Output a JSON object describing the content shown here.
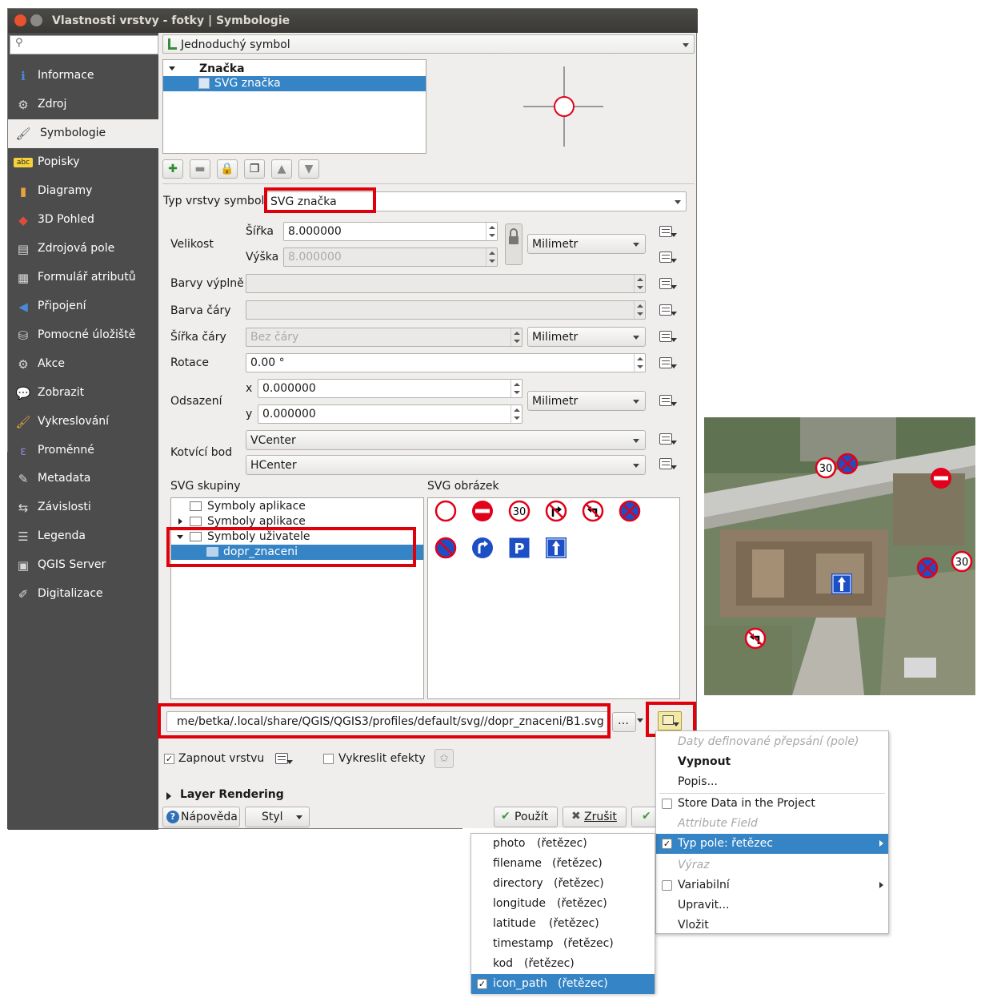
{
  "window": {
    "title": "Vlastnosti vrstvy - fotky | Symbologie"
  },
  "sidebar": {
    "items": [
      {
        "label": "Informace",
        "icon": "info-icon"
      },
      {
        "label": "Zdroj",
        "icon": "source-icon"
      },
      {
        "label": "Symbologie",
        "icon": "paintbrush-icon",
        "selected": true
      },
      {
        "label": "Popisky",
        "icon": "labels-icon"
      },
      {
        "label": "Diagramy",
        "icon": "diagram-icon"
      },
      {
        "label": "3D Pohled",
        "icon": "cube-icon"
      },
      {
        "label": "Zdrojová pole",
        "icon": "fields-icon"
      },
      {
        "label": "Formulář atributů",
        "icon": "form-icon"
      },
      {
        "label": "Připojení",
        "icon": "join-icon"
      },
      {
        "label": "Pomocné úložiště",
        "icon": "database-icon"
      },
      {
        "label": "Akce",
        "icon": "gear-icon"
      },
      {
        "label": "Zobrazit",
        "icon": "speech-bubble-icon"
      },
      {
        "label": "Vykreslování",
        "icon": "brush-icon"
      },
      {
        "label": "Proměnné",
        "icon": "epsilon-icon"
      },
      {
        "label": "Metadata",
        "icon": "metadata-icon"
      },
      {
        "label": "Závislosti",
        "icon": "dependencies-icon"
      },
      {
        "label": "Legenda",
        "icon": "legend-icon"
      },
      {
        "label": "QGIS Server",
        "icon": "server-icon"
      },
      {
        "label": "Digitalizace",
        "icon": "digitize-icon"
      }
    ]
  },
  "renderer": {
    "value": "Jednoduchý symbol"
  },
  "symbol_tree": {
    "root": "Značka",
    "child": "SVG značka"
  },
  "form": {
    "layer_type_label": "Typ vrstvy symbolu",
    "layer_type_value": "SVG značka",
    "size_label": "Velikost",
    "width_label": "Šířka",
    "width_value": "8.000000",
    "height_label": "Výška",
    "height_value": "8.000000",
    "unit": "Milimetr",
    "fill_color_label": "Barvy výplně",
    "stroke_color_label": "Barva čáry",
    "stroke_width_label": "Šířka čáry",
    "stroke_width_value": "Bez čáry",
    "rotation_label": "Rotace",
    "rotation_value": "0.00 °",
    "offset_label": "Odsazení",
    "offset_x_label": "x",
    "offset_x_value": "0.000000",
    "offset_y_label": "y",
    "offset_y_value": "0.000000",
    "anchor_label": "Kotvící bod",
    "anchor_v": "VCenter",
    "anchor_h": "HCenter"
  },
  "svg_groups": {
    "title": "SVG skupiny",
    "items": [
      "Symboly aplikace",
      "Symboly aplikace",
      "Symboly uživatele",
      "dopr_znaceni"
    ]
  },
  "svg_images": {
    "title": "SVG obrázek",
    "speed_text": "30",
    "parking_text": "P"
  },
  "path": {
    "value": "me/betka/.local/share/QGIS/QGIS3/profiles/default/svg//dopr_znaceni/B1.svg",
    "browse": "…"
  },
  "options": {
    "enable_layer": "Zapnout vrstvu",
    "draw_effects": "Vykreslit efekty",
    "layer_rendering": "Layer Rendering"
  },
  "buttons": {
    "help": "Nápověda",
    "style": "Styl",
    "apply": "Použít",
    "cancel": "Zrušit"
  },
  "map": {
    "speed_text": "30"
  },
  "context_menu": {
    "items": [
      {
        "label": "Daty definované přepsání (pole)",
        "style": "disabled"
      },
      {
        "label": "Vypnout",
        "style": "bold"
      },
      {
        "label": "Popis...",
        "style": "normal"
      },
      {
        "label": "Store Data in the Project",
        "style": "checkbox"
      },
      {
        "label": "Attribute Field",
        "style": "disabled"
      },
      {
        "label": "Typ pole: řetězec",
        "style": "selected"
      },
      {
        "label": "Výraz",
        "style": "disabled"
      },
      {
        "label": "Variabilní",
        "style": "checkbox"
      },
      {
        "label": "Upravit...",
        "style": "normal"
      },
      {
        "label": "Vložit",
        "style": "normal"
      }
    ]
  },
  "field_menu": {
    "type": "(řetězec)",
    "items": [
      "photo",
      "filename",
      "directory",
      "longitude",
      "latitude",
      "timestamp",
      "kod",
      "icon_path"
    ]
  }
}
